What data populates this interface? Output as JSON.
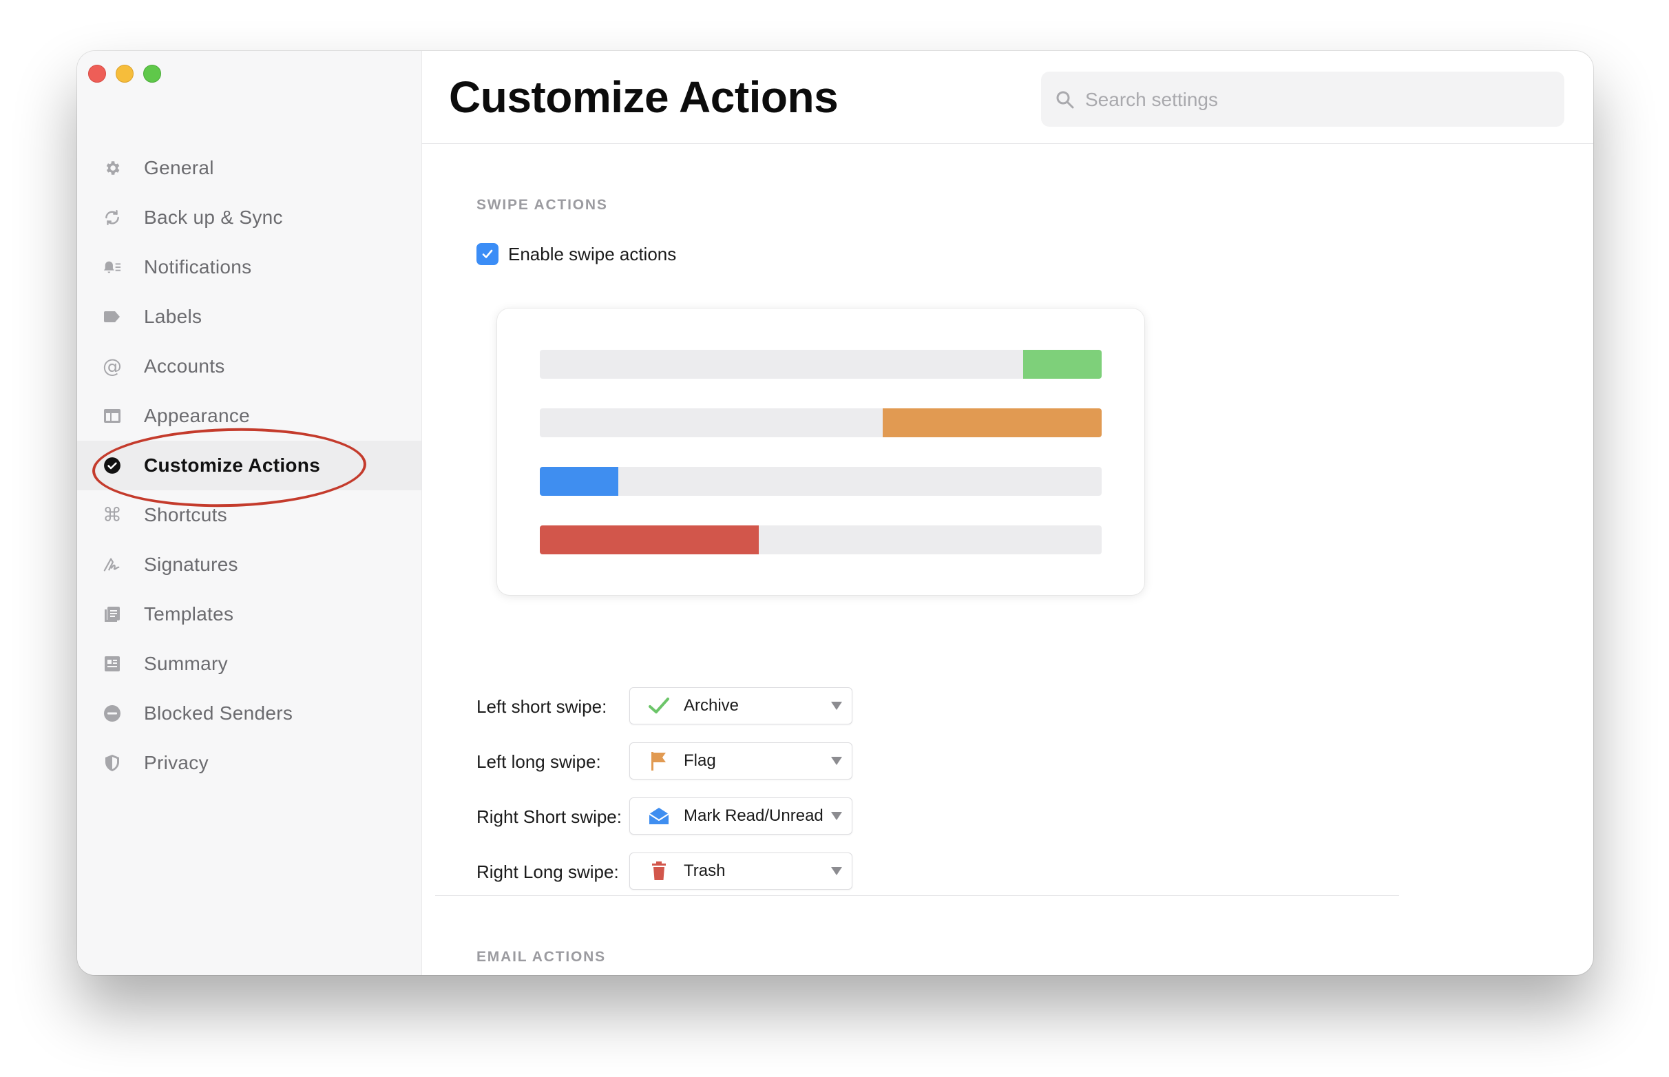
{
  "sidebar": {
    "items": [
      {
        "label": "General",
        "icon": "gear-icon"
      },
      {
        "label": "Back up & Sync",
        "icon": "sync-icon"
      },
      {
        "label": "Notifications",
        "icon": "bell-icon"
      },
      {
        "label": "Labels",
        "icon": "label-icon"
      },
      {
        "label": "Accounts",
        "icon": "at-icon"
      },
      {
        "label": "Appearance",
        "icon": "layout-icon"
      },
      {
        "label": "Customize Actions",
        "icon": "check-circle-icon",
        "active": true
      },
      {
        "label": "Shortcuts",
        "icon": "command-icon"
      },
      {
        "label": "Signatures",
        "icon": "signature-icon"
      },
      {
        "label": "Templates",
        "icon": "templates-icon"
      },
      {
        "label": "Summary",
        "icon": "summary-icon"
      },
      {
        "label": "Blocked Senders",
        "icon": "blocked-icon"
      },
      {
        "label": "Privacy",
        "icon": "shield-icon"
      }
    ]
  },
  "header": {
    "title": "Customize Actions",
    "search_placeholder": "Search settings"
  },
  "swipe_actions": {
    "section_label": "SWIPE ACTIONS",
    "enable_label": "Enable swipe actions",
    "enabled": true,
    "preview": [
      {
        "side": "right",
        "fraction": 0.14,
        "color": "#7ed07a"
      },
      {
        "side": "right",
        "fraction": 0.39,
        "color": "#e19a52"
      },
      {
        "side": "left",
        "fraction": 0.14,
        "color": "#3f8ef0"
      },
      {
        "side": "left",
        "fraction": 0.39,
        "color": "#d2564b"
      }
    ],
    "rows": [
      {
        "label": "Left short swipe:",
        "value": "Archive",
        "icon": "checkmark-icon"
      },
      {
        "label": "Left long swipe:",
        "value": "Flag",
        "icon": "flag-icon"
      },
      {
        "label": "Right Short swipe:",
        "value": "Mark Read/Unread",
        "icon": "envelope-open-icon"
      },
      {
        "label": "Right Long swipe:",
        "value": "Trash",
        "icon": "trash-icon"
      }
    ]
  },
  "email_actions": {
    "section_label": "EMAIL ACTIONS"
  },
  "colors": {
    "accent": "#3b8df6",
    "archive": "#7ed07a",
    "flag": "#e19a52",
    "read": "#3f8ef0",
    "trash": "#d2564b",
    "annotation": "#c43b2c"
  }
}
